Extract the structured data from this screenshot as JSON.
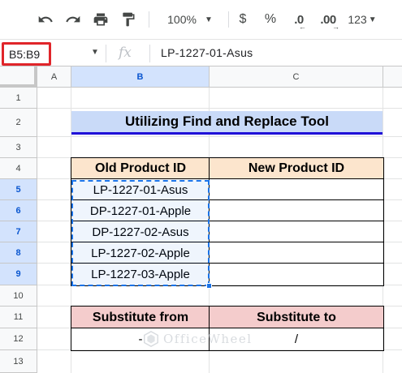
{
  "toolbar": {
    "icons": [
      "undo-icon",
      "redo-icon",
      "print-icon",
      "paint-format-icon"
    ],
    "zoom": "100%",
    "currency": "$",
    "percent": "%",
    "decrease_decimal": ".0",
    "increase_decimal": ".00",
    "more_formats": "123"
  },
  "formula_bar": {
    "name_box": "B5:B9",
    "fx_label": "fx",
    "content": "LP-1227-01-Asus"
  },
  "grid": {
    "columns": [
      "A",
      "B",
      "C"
    ],
    "rows": [
      "1",
      "2",
      "3",
      "4",
      "5",
      "6",
      "7",
      "8",
      "9",
      "10",
      "11",
      "12",
      "13"
    ],
    "selected_column": "B",
    "selected_rows": [
      "5",
      "6",
      "7",
      "8",
      "9"
    ]
  },
  "sheet": {
    "title": "Utilizing Find and Replace Tool",
    "table1": {
      "headers": [
        "Old Product ID",
        "New Product ID"
      ],
      "old_ids": [
        "LP-1227-01-Asus",
        "DP-1227-01-Apple",
        "DP-1227-02-Asus",
        "LP-1227-02-Apple",
        "LP-1227-03-Apple"
      ],
      "new_ids": [
        "",
        "",
        "",
        "",
        ""
      ]
    },
    "table2": {
      "headers": [
        "Substitute from",
        "Substitute to"
      ],
      "values": [
        "-",
        "/"
      ]
    }
  },
  "watermark": "OfficeWheel",
  "colors": {
    "title_fill": "#c9daf8",
    "title_underline": "#1f10d8",
    "header_peach": "#fce5cd",
    "header_pink": "#f4cccc",
    "selection": "#1a73e8",
    "namebox_highlight": "#e0252a"
  }
}
